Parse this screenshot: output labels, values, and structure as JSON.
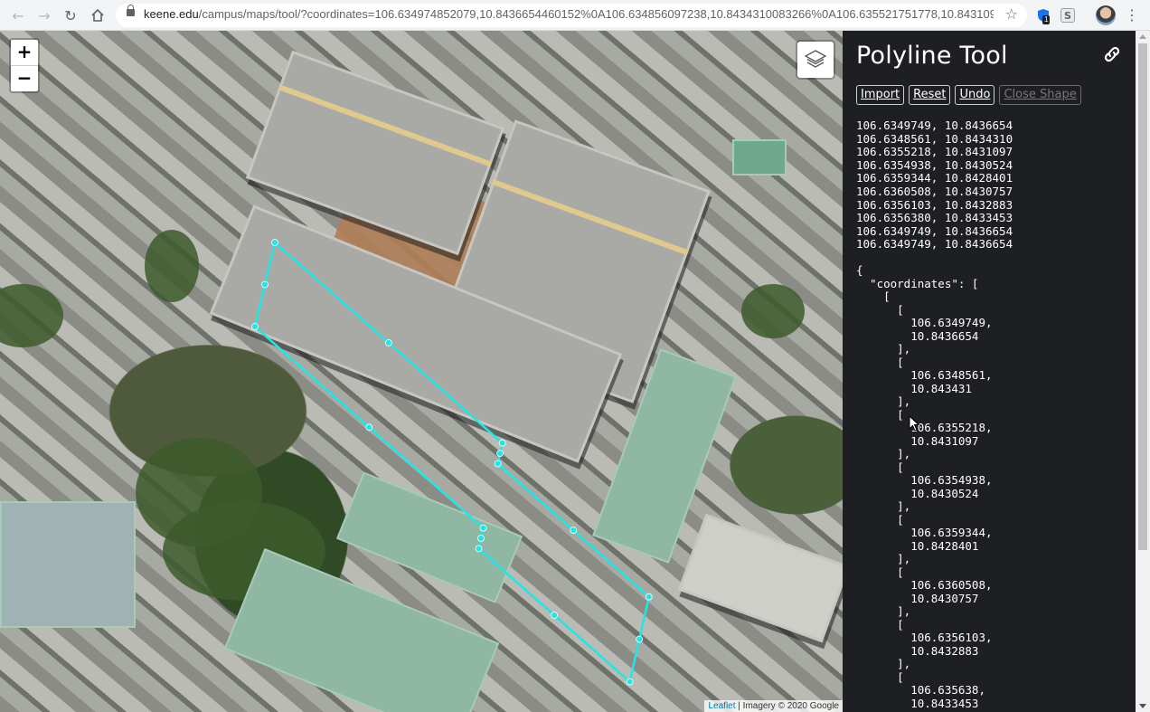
{
  "browser": {
    "url_host": "keene.edu",
    "url_path": "/campus/maps/tool/?coordinates=106.634974852079,10.8436654460152%0A106.634856097238,10.8434310083266%0A106.635521751778,10.8431096987...",
    "ext_badge": "1",
    "ext_s_label": "S"
  },
  "map": {
    "zoom_in_label": "+",
    "zoom_out_label": "−",
    "attribution_leaflet": "Leaflet",
    "attribution_rest": " | Imagery © 2020 Google",
    "polyline_color": "#22e6e6"
  },
  "panel": {
    "title": "Polyline Tool",
    "buttons": {
      "import": "Import",
      "reset": "Reset",
      "undo": "Undo",
      "close_shape": "Close Shape"
    },
    "coordinate_lines": [
      "106.6349749, 10.8436654",
      "106.6348561, 10.8434310",
      "106.6355218, 10.8431097",
      "106.6354938, 10.8430524",
      "106.6359344, 10.8428401",
      "106.6360508, 10.8430757",
      "106.6356103, 10.8432883",
      "106.6356380, 10.8433453",
      "106.6349749, 10.8436654",
      "106.6349749, 10.8436654"
    ],
    "json_text": "{\n  \"coordinates\": [\n    [\n      [\n        106.6349749,\n        10.8436654\n      ],\n      [\n        106.6348561,\n        10.843431\n      ],\n      [\n        106.6355218,\n        10.8431097\n      ],\n      [\n        106.6354938,\n        10.8430524\n      ],\n      [\n        106.6359344,\n        10.8428401\n      ],\n      [\n        106.6360508,\n        10.8430757\n      ],\n      [\n        106.6356103,\n        10.8432883\n      ],\n      [\n        106.635638,\n        10.8433453"
  }
}
